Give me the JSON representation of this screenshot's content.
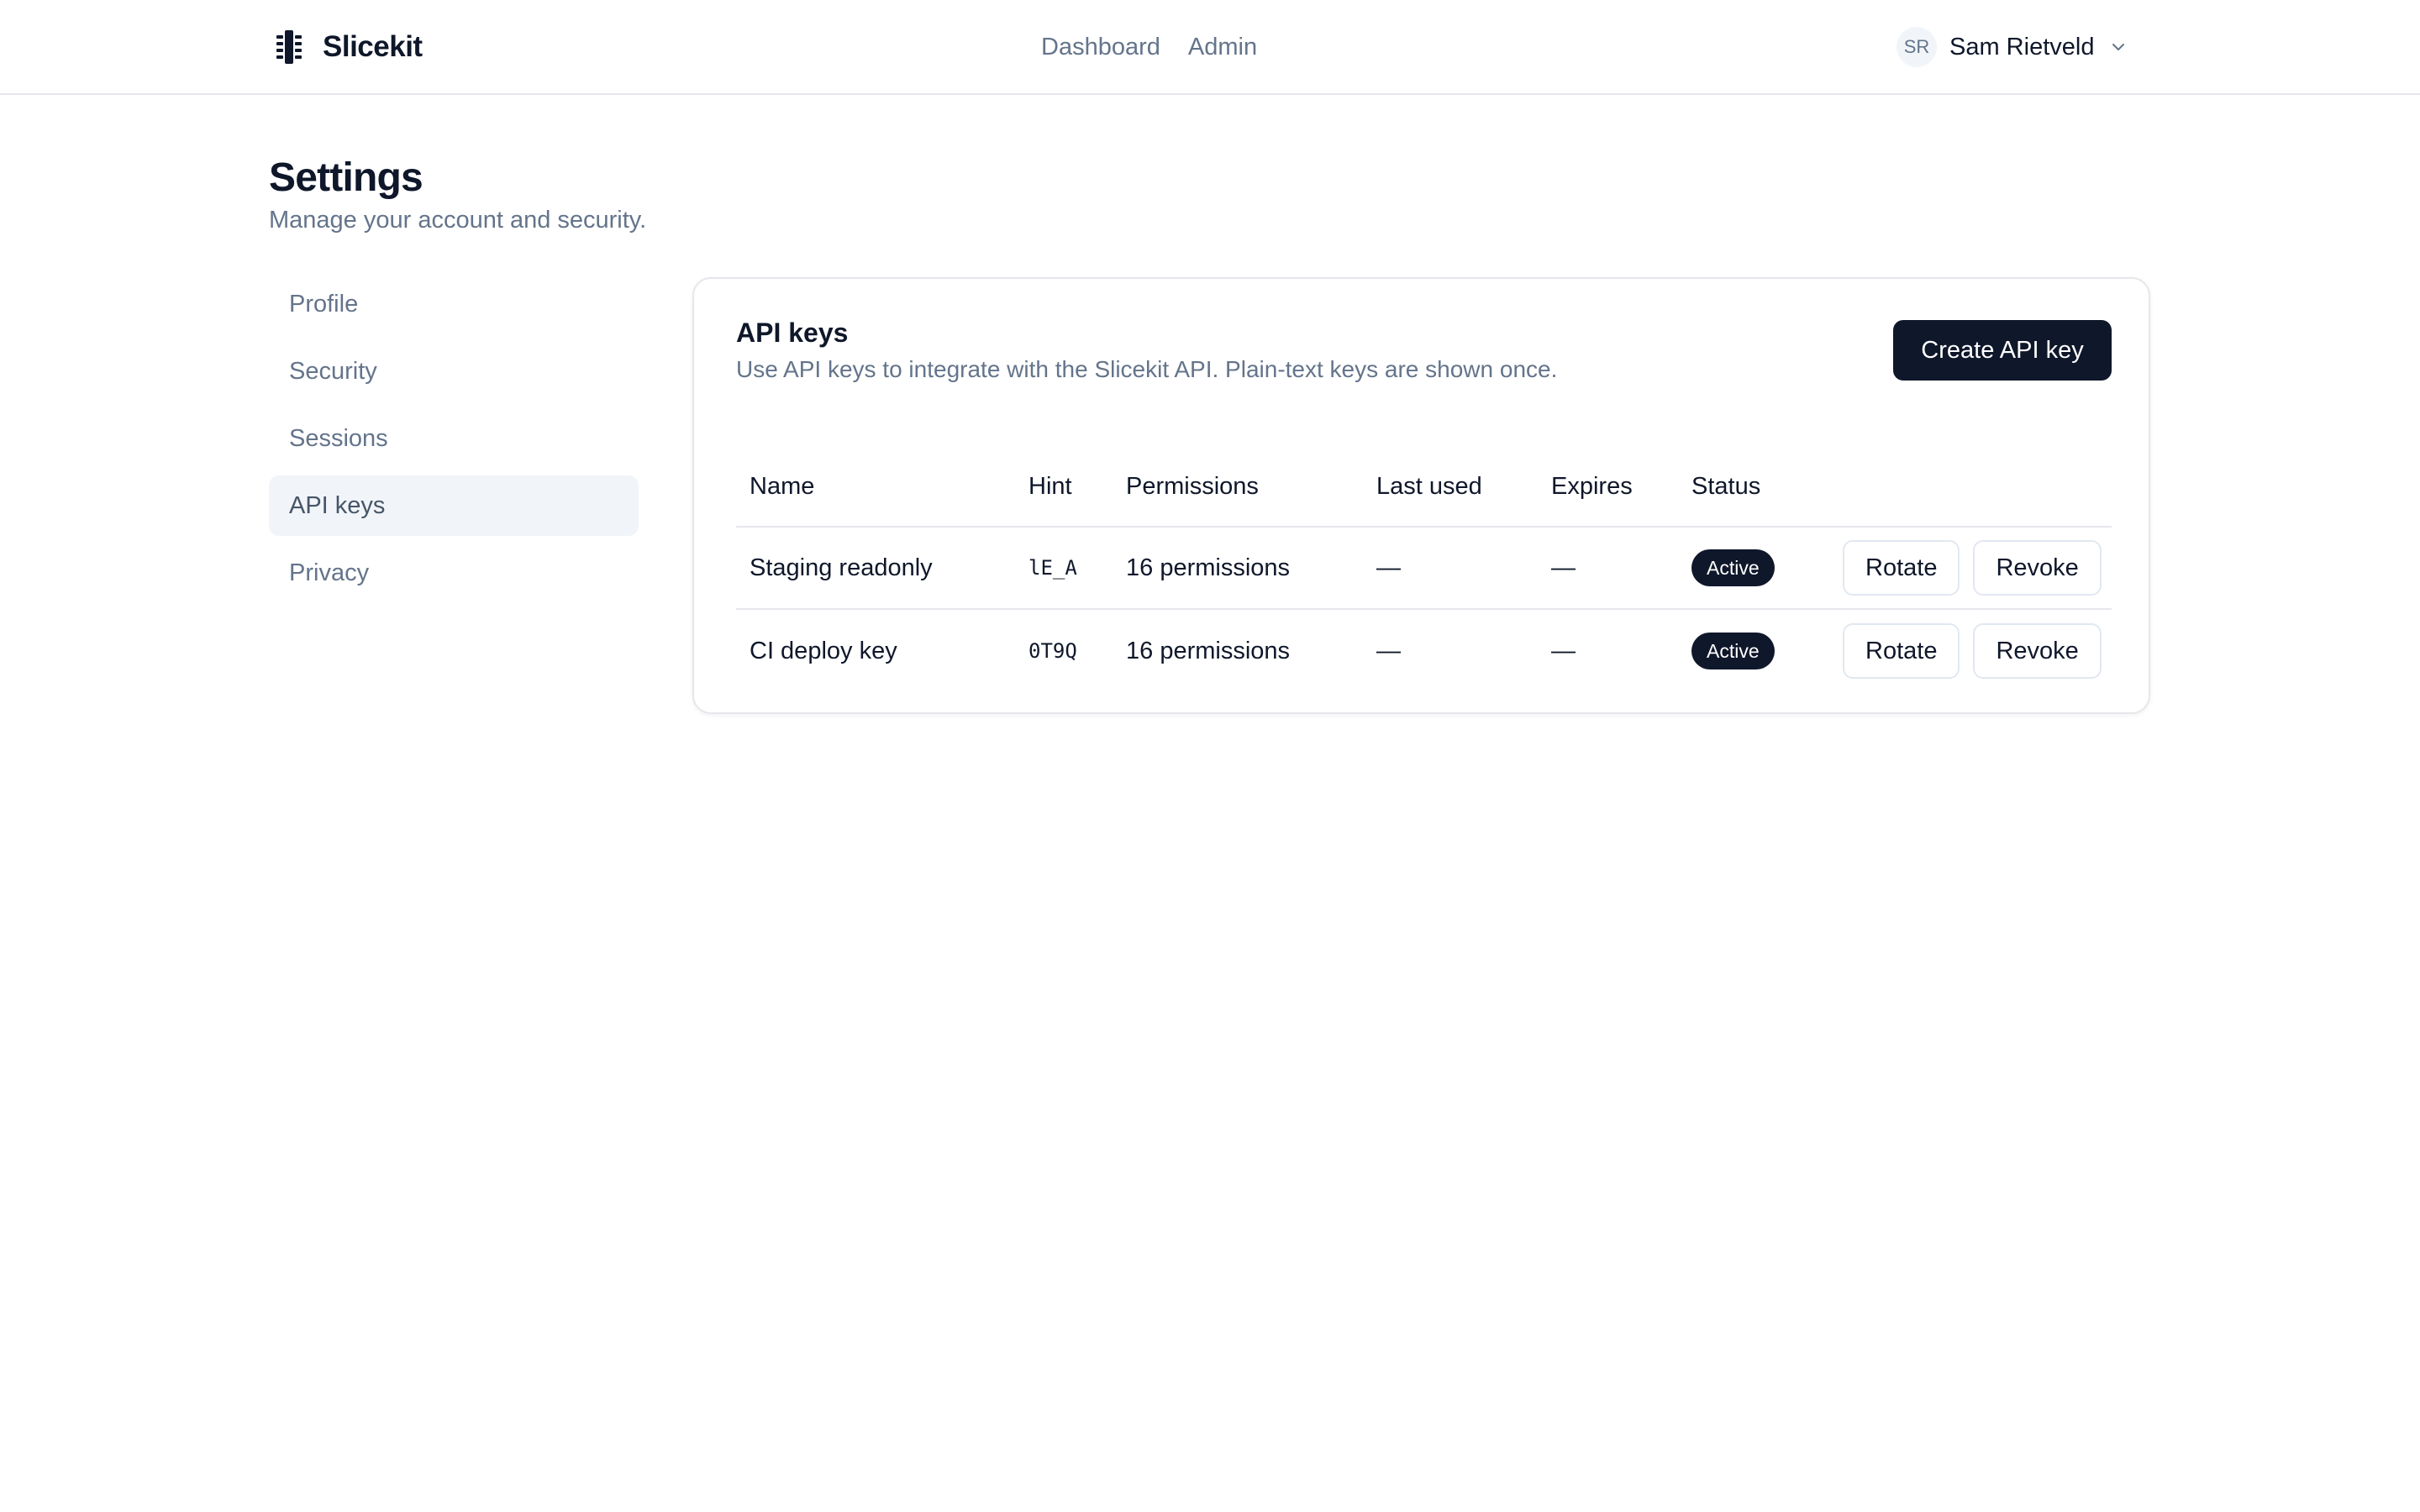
{
  "header": {
    "brand": "Slicekit",
    "nav": [
      {
        "label": "Dashboard"
      },
      {
        "label": "Admin"
      }
    ],
    "user": {
      "initials": "SR",
      "name": "Sam Rietveld"
    }
  },
  "page": {
    "title": "Settings",
    "subtitle": "Manage your account and security."
  },
  "sidebar": {
    "items": [
      {
        "label": "Profile",
        "active": false
      },
      {
        "label": "Security",
        "active": false
      },
      {
        "label": "Sessions",
        "active": false
      },
      {
        "label": "API keys",
        "active": true
      },
      {
        "label": "Privacy",
        "active": false
      }
    ]
  },
  "card": {
    "title": "API keys",
    "description": "Use API keys to integrate with the Slicekit API. Plain-text keys are shown once.",
    "create_label": "Create API key",
    "columns": {
      "name": "Name",
      "hint": "Hint",
      "permissions": "Permissions",
      "last_used": "Last used",
      "expires": "Expires",
      "status": "Status"
    },
    "rows": [
      {
        "name": "Staging readonly",
        "hint": "lE_A",
        "permissions": "16 permissions",
        "last_used": "—",
        "expires": "—",
        "status": "Active",
        "rotate": "Rotate",
        "revoke": "Revoke"
      },
      {
        "name": "CI deploy key",
        "hint": "0T9Q",
        "permissions": "16 permissions",
        "last_used": "—",
        "expires": "—",
        "status": "Active",
        "rotate": "Rotate",
        "revoke": "Revoke"
      }
    ]
  },
  "colors": {
    "primary": "#0f172a",
    "muted": "#64748b",
    "border": "#e5e7eb",
    "active_bg": "#f1f5f9"
  }
}
